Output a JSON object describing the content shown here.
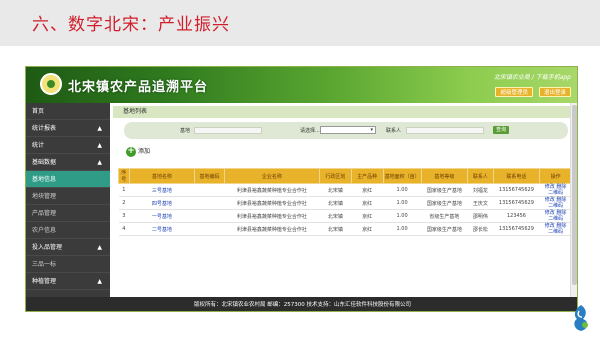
{
  "slide": {
    "title": "六、数字北宋：产业振兴"
  },
  "app": {
    "title": "北宋镇农产品追溯平台",
    "header_right": "北宋镇农业局 / 下载手机app",
    "btn_user": "超级管理员",
    "btn_logout": "退出登录"
  },
  "sidebar": {
    "items": [
      {
        "label": "首页",
        "arrow": ""
      },
      {
        "label": "统计报表",
        "arrow": "▲"
      },
      {
        "label": "统计",
        "arrow": "▲"
      },
      {
        "label": "基础数据",
        "arrow": "▲"
      },
      {
        "label": "基地信息",
        "arrow": ""
      },
      {
        "label": "地块管理",
        "arrow": ""
      },
      {
        "label": "产品管理",
        "arrow": ""
      },
      {
        "label": "农户信息",
        "arrow": ""
      },
      {
        "label": "投入品管理",
        "arrow": "▲"
      },
      {
        "label": "三品一标",
        "arrow": ""
      },
      {
        "label": "种植管理",
        "arrow": "▲"
      }
    ]
  },
  "main": {
    "breadcrumb": "基地列表",
    "search": {
      "label_base": "基地",
      "select_value": "请选择...",
      "label_contact": "联系人",
      "button": "查询"
    },
    "add_label": "添加",
    "table": {
      "headers": [
        "序号",
        "基地名称",
        "基地编码",
        "企业名称",
        "行政区划",
        "主产品种",
        "基地面积（亩）",
        "基地等级",
        "联系人",
        "联系电话",
        "操作"
      ],
      "rows": [
        {
          "no": "1",
          "name": "三号基地",
          "code": "",
          "company": "利津县裕鑫蔬菜种植专业合作社",
          "region": "北宋镇",
          "product": "京红",
          "area": "1.00",
          "level": "国家级生产基地",
          "contact": "刘福龙",
          "phone": "13156745629",
          "op1": "修改",
          "op2": "删除",
          "op3": "二维码"
        },
        {
          "no": "2",
          "name": "四号基地",
          "code": "",
          "company": "利津县裕鑫蔬菜种植专业合作社",
          "region": "北宋镇",
          "product": "京红",
          "area": "1.00",
          "level": "国家级生产基地",
          "contact": "王庆文",
          "phone": "13156745629",
          "op1": "修改",
          "op2": "删除",
          "op3": "二维码"
        },
        {
          "no": "3",
          "name": "一号基地",
          "code": "",
          "company": "利津县裕鑫蔬菜种植专业合作社",
          "region": "北宋镇",
          "product": "京红",
          "area": "1.00",
          "level": "省级生产基地",
          "contact": "邵明伟",
          "phone": "123456",
          "op1": "修改",
          "op2": "删除",
          "op3": "二维码"
        },
        {
          "no": "4",
          "name": "二号基地",
          "code": "",
          "company": "利津县裕鑫蔬菜种植专业合作社",
          "region": "北宋镇",
          "product": "京红",
          "area": "1.00",
          "level": "国家级生产基地",
          "contact": "邵长松",
          "phone": "13156745629",
          "op1": "修改",
          "op2": "删除",
          "op3": "二维码"
        }
      ]
    }
  },
  "footer": {
    "text": "版权所有：北宋镇农业农村局   邮编：257300     技术支持：山东汇佳软件科技股份有限公司"
  },
  "colors": {
    "slide_title": "#d01e2b",
    "header_green": "#2f7a1e",
    "table_header": "#e8b32a",
    "active_sidebar": "#2e9c86",
    "link_blue": "#1a3fb5"
  }
}
